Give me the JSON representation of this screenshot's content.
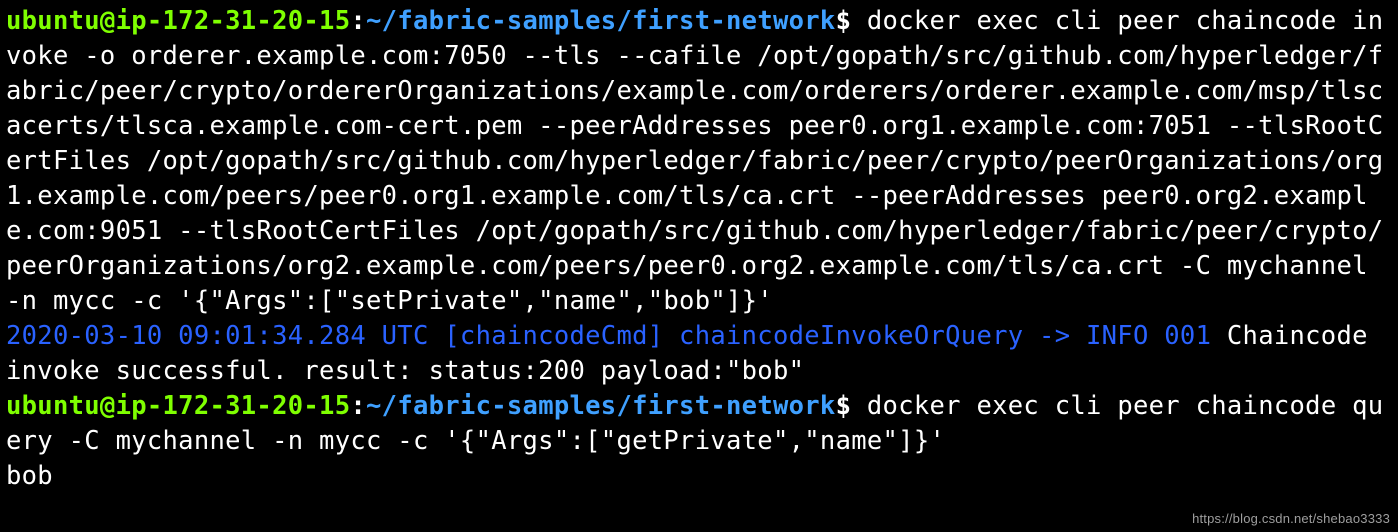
{
  "prompt": {
    "user_host": "ubuntu@ip-172-31-20-15",
    "separator1": ":",
    "cwd": "~/fabric-samples/first-network",
    "symbol": "$"
  },
  "lines": {
    "cmd1": " docker exec cli peer chaincode invoke -o orderer.example.com:7050 --tls --cafile /opt/gopath/src/github.com/hyperledger/fabric/peer/crypto/ordererOrganizations/example.com/orderers/orderer.example.com/msp/tlscacerts/tlsca.example.com-cert.pem --peerAddresses peer0.org1.example.com:7051 --tlsRootCertFiles /opt/gopath/src/github.com/hyperledger/fabric/peer/crypto/peerOrganizations/org1.example.com/peers/peer0.org1.example.com/tls/ca.crt --peerAddresses peer0.org2.example.com:9051 --tlsRootCertFiles /opt/gopath/src/github.com/hyperledger/fabric/peer/crypto/peerOrganizations/org2.example.com/peers/peer0.org2.example.com/tls/ca.crt -C mychannel -n mycc -c '{\"Args\":[\"setPrivate\",\"name\",\"bob\"]}'",
    "log_prefix": "2020-03-10 09:01:34.284 UTC [chaincodeCmd] chaincodeInvokeOrQuery -> INFO 001",
    "log_msg": " Chaincode invoke successful. result: status:200 payload:\"bob\"",
    "cmd2": " docker exec cli peer chaincode query -C mychannel -n mycc -c '{\"Args\":[\"getPrivate\",\"name\"]}'",
    "result": "bob"
  },
  "watermark": "https://blog.csdn.net/shebao3333"
}
